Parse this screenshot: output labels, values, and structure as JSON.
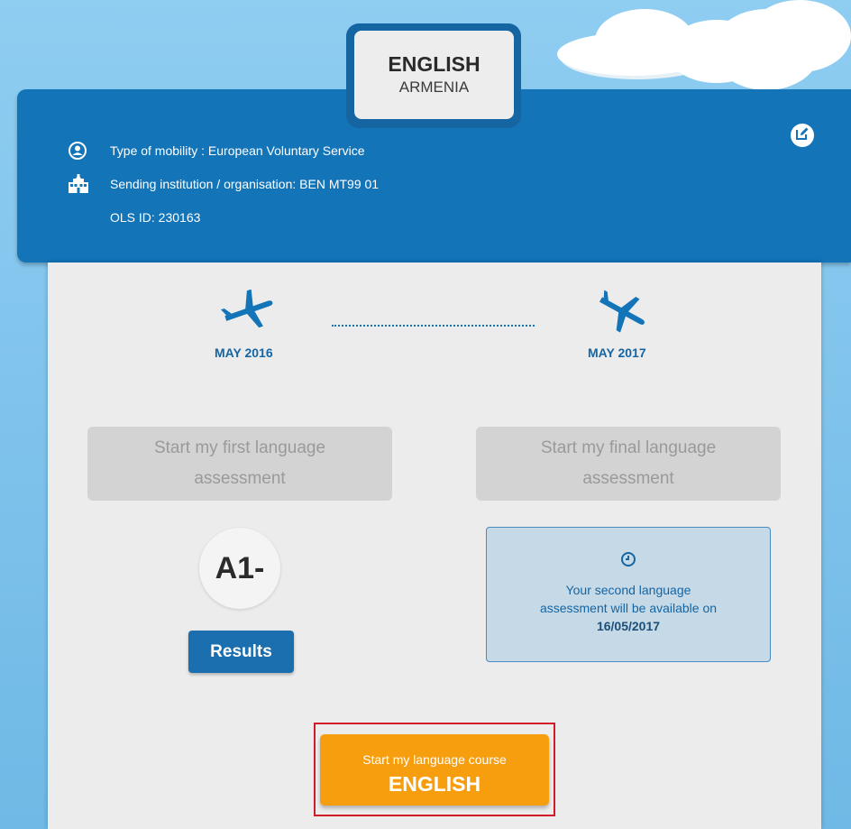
{
  "badge": {
    "language": "ENGLISH",
    "country": "ARMENIA"
  },
  "info": {
    "mobility_type": "Type of mobility : European Voluntary Service",
    "sending_institution": "Sending institution / organisation: BEN MT99 01",
    "ols_id": "OLS ID: 230163"
  },
  "icons": {
    "user": "user-circle-icon",
    "institution": "building-icon",
    "edit": "edit-icon",
    "departure": "plane-takeoff-icon",
    "arrival": "plane-landing-icon",
    "clock": "clock-icon"
  },
  "timeline": {
    "start_date": "MAY 2016",
    "end_date": "MAY 2017"
  },
  "assessments": {
    "first_label_line1": "Start my first language",
    "first_label_line2": "assessment",
    "final_label_line1": "Start my final language",
    "final_label_line2": "assessment",
    "level": "A1-",
    "results_label": "Results"
  },
  "notice": {
    "line1": "Your second language",
    "line2": "assessment will be available on",
    "date": "16/05/2017"
  },
  "course": {
    "subtitle": "Start my language course",
    "language": "ENGLISH"
  },
  "colors": {
    "primary_blue": "#1374b8",
    "accent_orange": "#f79e0e",
    "disabled_gray": "#d3d3d3",
    "highlight_red": "#d11a2a"
  }
}
